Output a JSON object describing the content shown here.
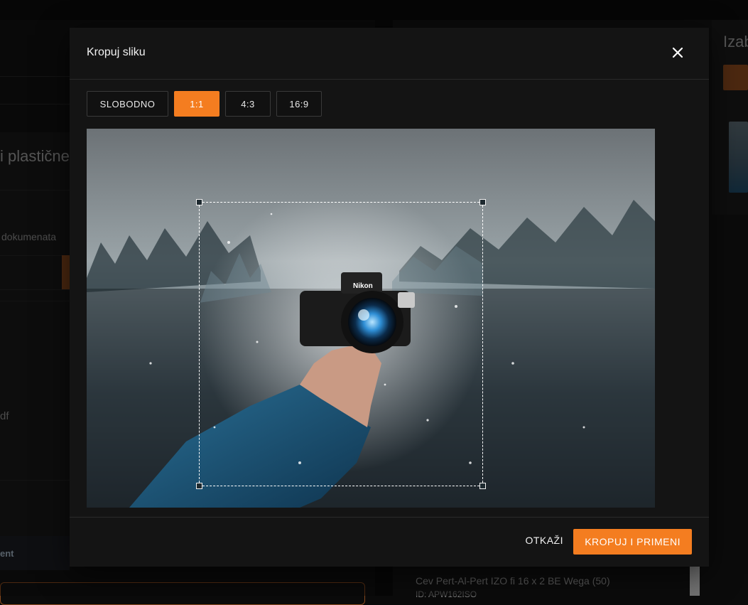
{
  "background": {
    "left_heading": "i plastične",
    "left_documents": "dokumenata",
    "left_file": "df",
    "left_section": "ent",
    "right_heading": "Izab",
    "product_name": "Cev Pert-Al-Pert IZO fi 16 x 2 BE Wega (50)",
    "product_id": "ID: APW162ISO"
  },
  "modal": {
    "title": "Kropuj sliku",
    "aspect_options": [
      "SLOBODNO",
      "1:1",
      "4:3",
      "16:9"
    ],
    "selected_aspect": "1:1",
    "cancel_label": "OTKAŽI",
    "apply_label": "KROPUJ I PRIMENI",
    "camera_brand": "Nikon"
  },
  "colors": {
    "accent": "#f47d20",
    "modal_bg": "#141414",
    "page_bg": "#0b0b0b"
  }
}
